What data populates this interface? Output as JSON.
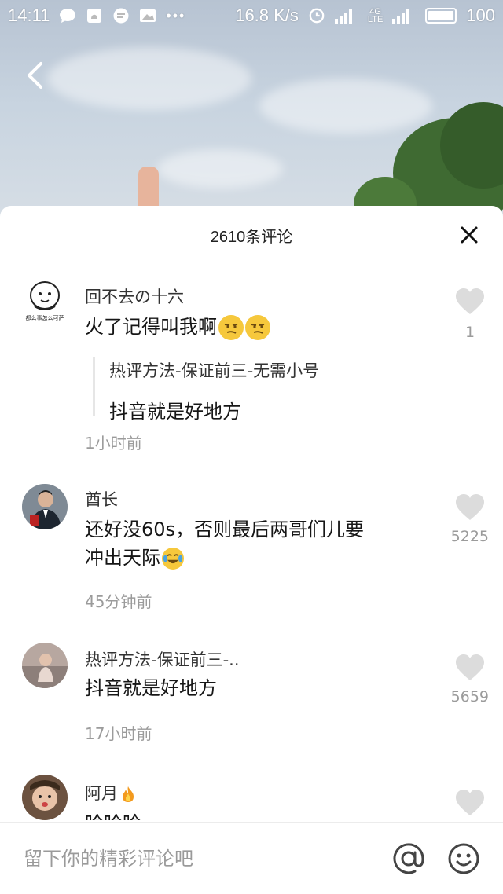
{
  "status_bar": {
    "time": "14:11",
    "network_speed": "16.8 K/s",
    "battery": "100"
  },
  "sheet": {
    "title": "2610条评论",
    "input_placeholder": "留下你的精彩评论吧"
  },
  "comments": [
    {
      "user": "回不去の十六",
      "avatar_caption": "都么事怎么可萨",
      "text": "火了记得叫我啊",
      "emoji": [
        "smirk-emoji",
        "smirk-emoji"
      ],
      "reply": {
        "user": "热评方法-保证前三-无需小号",
        "text": "抖音就是好地方"
      },
      "time": "1小时前",
      "likes": "1"
    },
    {
      "user": "酋长",
      "text_line1": "还好没60s，否则最后两哥们儿要",
      "text_line2": "冲出天际",
      "emoji": [
        "tears-of-joy-emoji"
      ],
      "time": "45分钟前",
      "likes": "5225"
    },
    {
      "user": "热评方法-保证前三-..",
      "text": "抖音就是好地方",
      "time": "17小时前",
      "likes": "5659"
    },
    {
      "user": "阿月",
      "user_badge": "fire-icon",
      "text": "哈哈哈",
      "likes": ""
    }
  ],
  "colors": {
    "sheet_bg": "#ffffff",
    "name_text": "#333333",
    "meta_text": "#9b9b9b",
    "heart_icon": "#dcdcdc"
  }
}
